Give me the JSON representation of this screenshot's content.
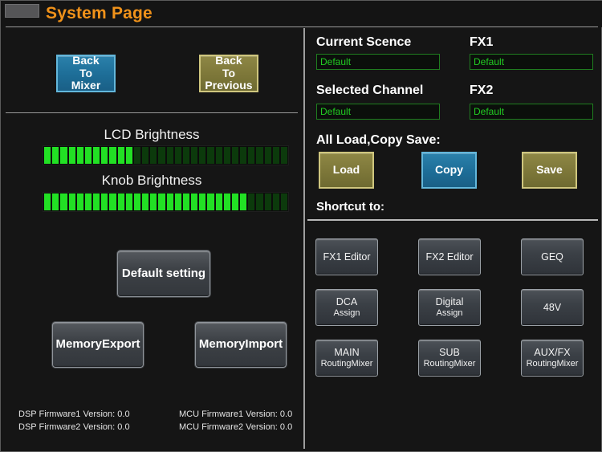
{
  "window": {
    "title": "System Page",
    "home_button_name": "home-box"
  },
  "colors": {
    "accent_title": "#f0921a",
    "blue_button": "#1d6d97",
    "olive_button": "#7d7739",
    "meter_on": "#22e024",
    "meter_off": "#0c3a0c",
    "field_text": "#22cc22"
  },
  "left_panel": {
    "back_to_mixer": "Back\nTo\nMixer",
    "back_to_mixer_lines": [
      "Back",
      "To",
      "Mixer"
    ],
    "back_to_previous_lines": [
      "Back",
      "To",
      "Previous"
    ],
    "lcd_brightness_label": "LCD Brightness",
    "knob_brightness_label": "Knob Brightness",
    "lcd_brightness_segments_total": 30,
    "lcd_brightness_segments_on": 11,
    "knob_brightness_segments_total": 30,
    "knob_brightness_segments_on": 25,
    "default_setting": "Default setting",
    "memory_export": "MemoryExport",
    "memory_import": "MemoryImport",
    "firmware": {
      "dsp1": "DSP Firmware1 Version: 0.0",
      "dsp2": "DSP Firmware2 Version: 0.0",
      "mcu1": "MCU Firmware1 Version: 0.0",
      "mcu2": "MCU Firmware2 Version: 0.0"
    }
  },
  "right_panel": {
    "fields": {
      "current_scence_label": "Current Scence",
      "current_scence_value": "Default",
      "fx1_label": "FX1",
      "fx1_value": "Default",
      "selected_channel_label": "Selected Channel",
      "selected_channel_value": "Default",
      "fx2_label": "FX2",
      "fx2_value": "Default"
    },
    "all_load_copy_save_label": "All Load,Copy Save:",
    "load_label": "Load",
    "copy_label": "Copy",
    "save_label": "Save",
    "shortcut_label": "Shortcut to:",
    "shortcuts": [
      {
        "line1": "FX1 Editor",
        "line2": ""
      },
      {
        "line1": "FX2 Editor",
        "line2": ""
      },
      {
        "line1": "GEQ",
        "line2": ""
      },
      {
        "line1": "DCA",
        "line2": "Assign"
      },
      {
        "line1": "Digital",
        "line2": "Assign"
      },
      {
        "line1": "48V",
        "line2": ""
      },
      {
        "line1": "MAIN",
        "line2": "RoutingMixer"
      },
      {
        "line1": "SUB",
        "line2": "RoutingMixer"
      },
      {
        "line1": "AUX/FX",
        "line2": "RoutingMixer"
      }
    ]
  }
}
